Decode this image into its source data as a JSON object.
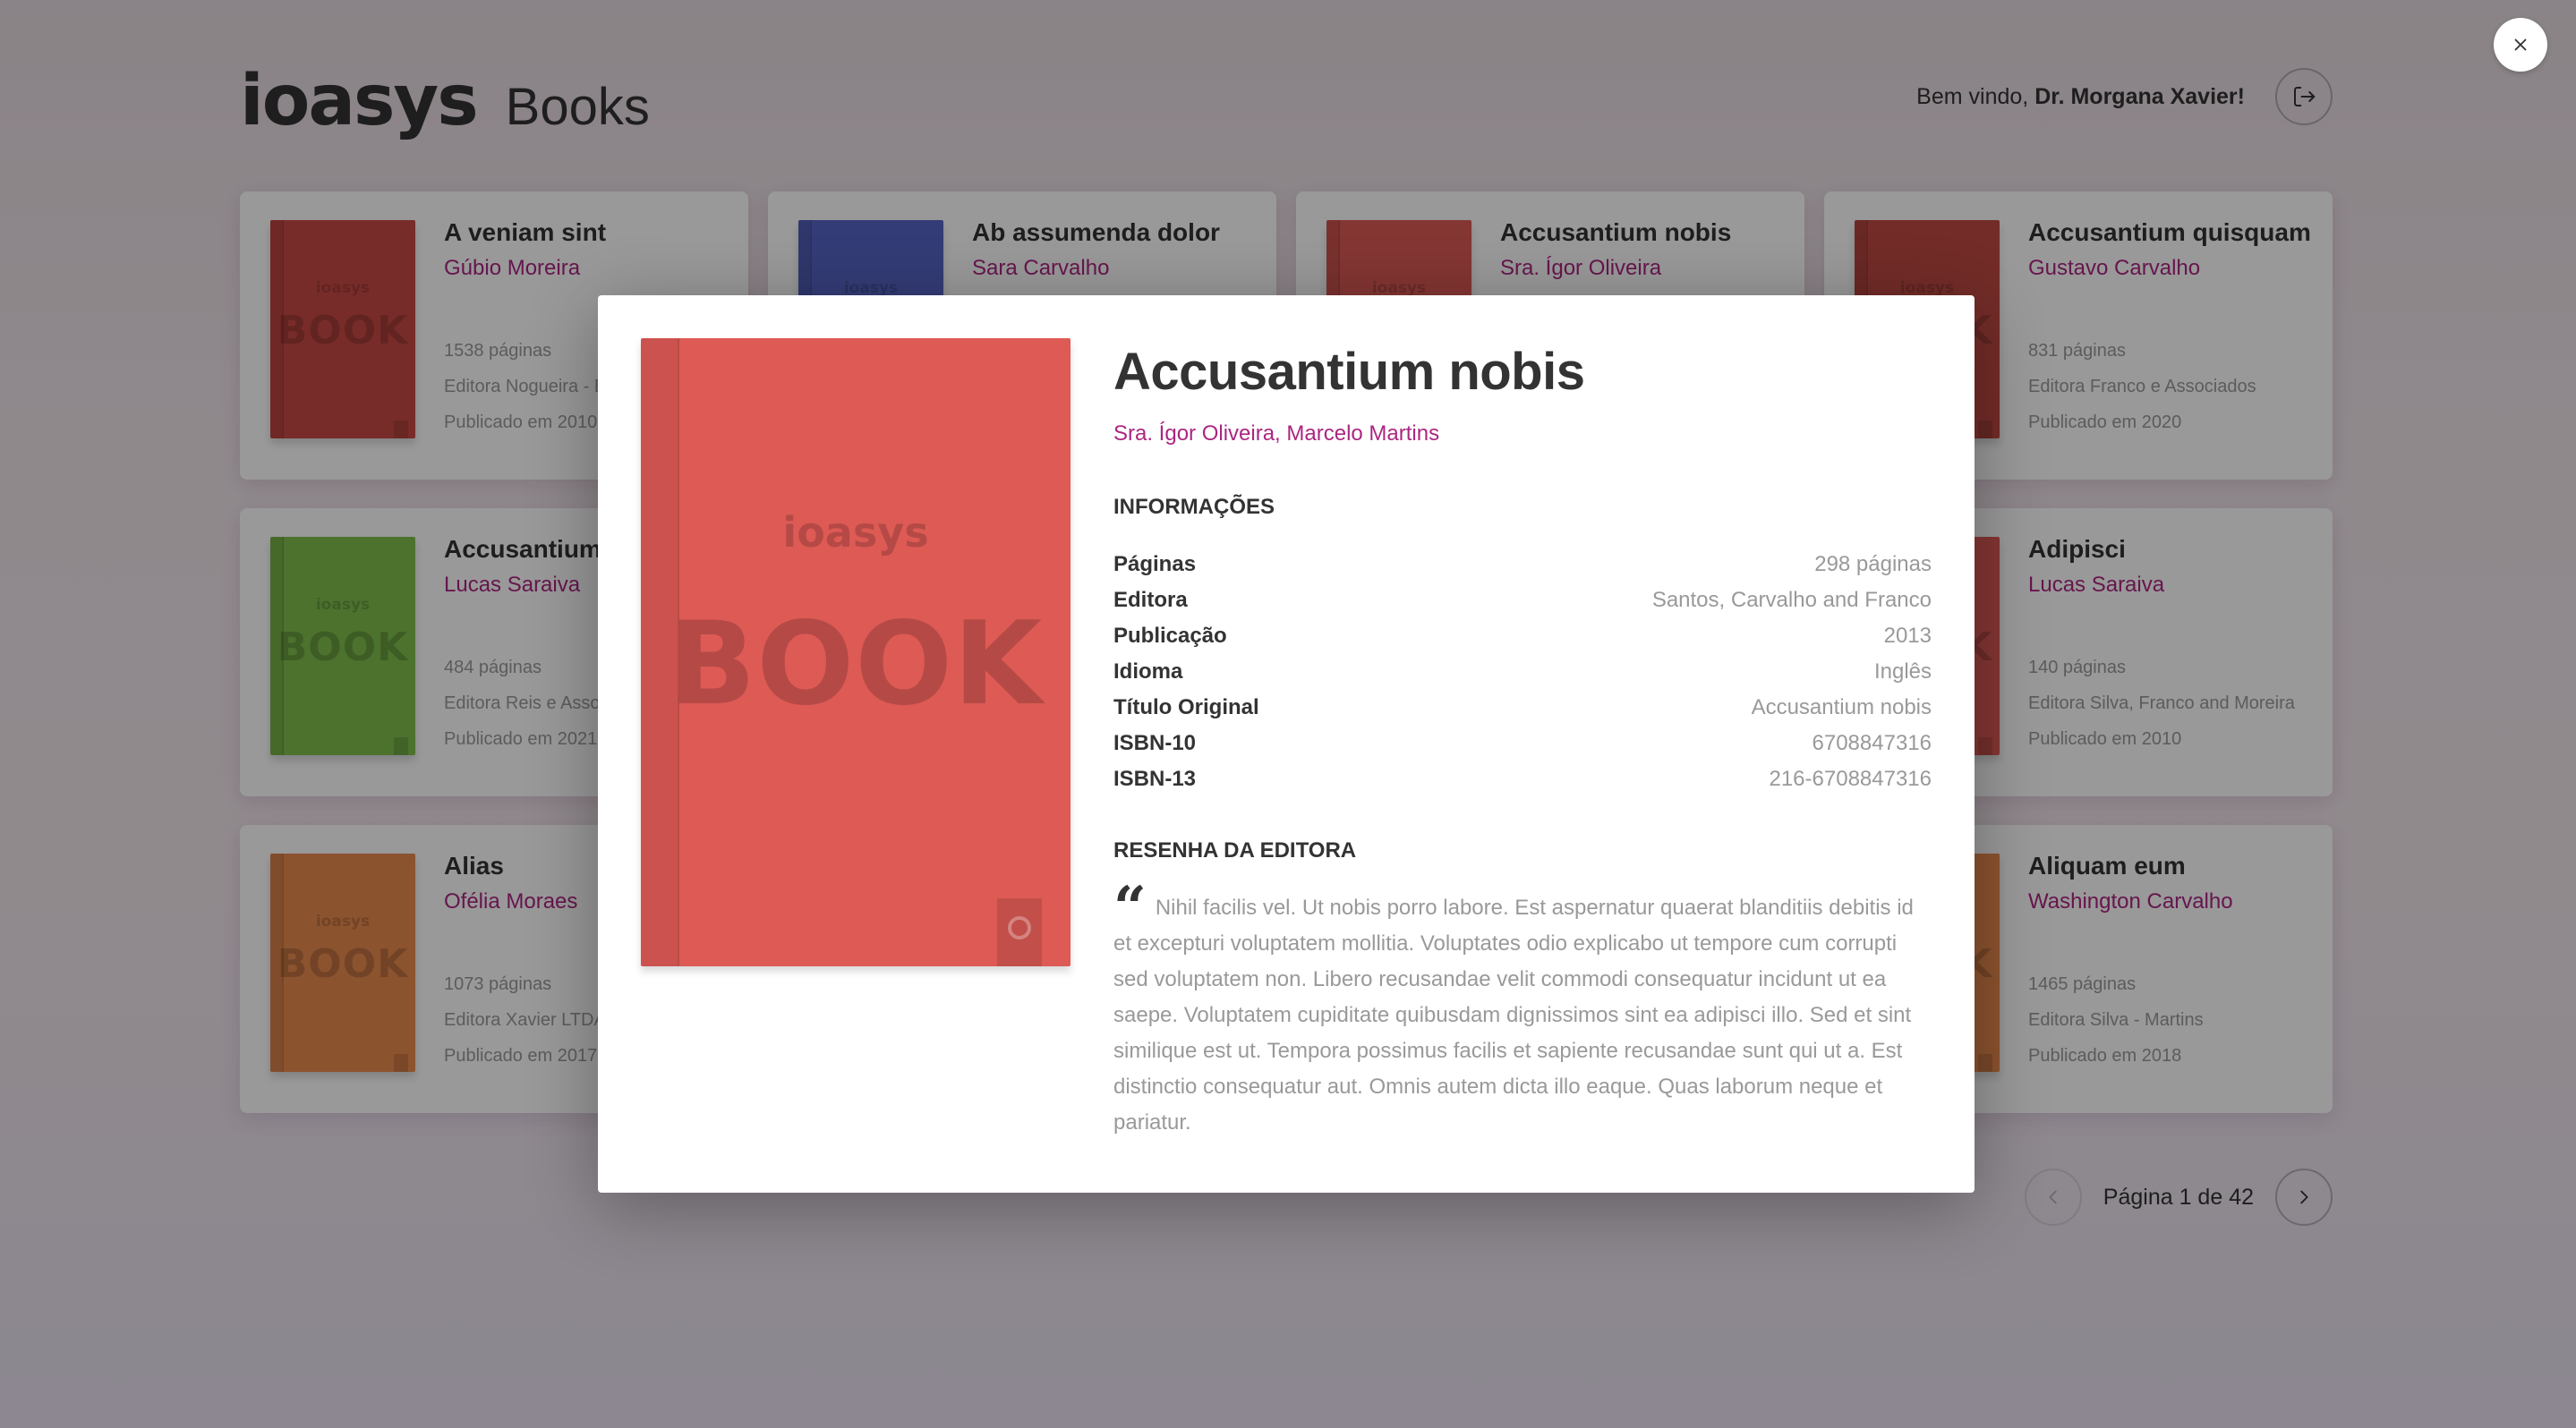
{
  "header": {
    "brand": "ioasys",
    "subtitle": "Books",
    "welcome_prefix": "Bem vindo, ",
    "user_name": "Dr. Morgana Xavier!",
    "logout_icon": "logout-icon"
  },
  "cover_text": {
    "brand": "ioasys",
    "word": "BOOK"
  },
  "books": [
    {
      "title": "A veniam sint",
      "authors": "Gúbio Moreira",
      "pages": "1538 páginas",
      "publisher": "Editora Nogueira - E",
      "published": "Publicado em 2010",
      "color": "#c94a45"
    },
    {
      "title": "Ab assumenda dolor",
      "authors": "Sara Carvalho",
      "pages": "",
      "publisher": "",
      "published": "",
      "color": "#5865c6"
    },
    {
      "title": "Accusantium nobis",
      "authors": "Sra. Ígor Oliveira",
      "pages": "",
      "publisher": "",
      "published": "",
      "color": "#dd5a55"
    },
    {
      "title": "Accusantium quisquam",
      "authors": "Gustavo Carvalho",
      "pages": "831 páginas",
      "publisher": "Editora Franco e Associados",
      "published": "Publicado em 2020",
      "color": "#c04a44"
    },
    {
      "title": "Accusantium",
      "authors": "Lucas Saraiva",
      "pages": "484 páginas",
      "publisher": "Editora Reis e Asso",
      "published": "Publicado em 2021",
      "color": "#7fbe4e"
    },
    {
      "title": "",
      "authors": "",
      "pages": "",
      "publisher": "",
      "published": "",
      "color": "#f1d7df"
    },
    {
      "title": "",
      "authors": "",
      "pages": "",
      "publisher": "",
      "published": "",
      "color": "#f1d7df"
    },
    {
      "title": "Adipisci",
      "authors": "Lucas Saraiva",
      "pages": "140 páginas",
      "publisher": "Editora Silva, Franco and Moreira",
      "published": "Publicado em 2010",
      "color": "#dd5a55"
    },
    {
      "title": "Alias",
      "authors": "Ofélia Moraes",
      "pages": "1073 páginas",
      "publisher": "Editora Xavier LTDA",
      "published": "Publicado em 2017",
      "color": "#e98a4f"
    },
    {
      "title": "",
      "authors": "",
      "pages": "",
      "publisher": "",
      "published": "",
      "color": "#f1d7df"
    },
    {
      "title": "",
      "authors": "",
      "pages": "",
      "publisher": "",
      "published": "",
      "color": "#f1d7df"
    },
    {
      "title": "Aliquam eum",
      "authors": "Washington Carvalho",
      "pages": "1465 páginas",
      "publisher": "Editora Silva - Martins",
      "published": "Publicado em 2018",
      "color": "#e98a4f"
    }
  ],
  "pagination": {
    "label": "Página 1 de 42",
    "prev_icon": "chevron-left-icon",
    "next_icon": "chevron-right-icon"
  },
  "modal": {
    "title": "Accusantium nobis",
    "authors": "Sra. Ígor Oliveira, Marcelo Martins",
    "cover_color": "#dd5a55",
    "info_heading": "INFORMAÇÕES",
    "info": [
      {
        "label": "Páginas",
        "value": "298 páginas"
      },
      {
        "label": "Editora",
        "value": "Santos, Carvalho and Franco"
      },
      {
        "label": "Publicação",
        "value": "2013"
      },
      {
        "label": "Idioma",
        "value": "Inglês"
      },
      {
        "label": "Título Original",
        "value": "Accusantium nobis"
      },
      {
        "label": "ISBN-10",
        "value": "6708847316"
      },
      {
        "label": "ISBN-13",
        "value": "216-6708847316"
      }
    ],
    "review_heading": "RESENHA DA EDITORA",
    "quote_mark": "“",
    "review": "Nihil facilis vel. Ut nobis porro labore. Est aspernatur quaerat blanditiis debitis id et excepturi voluptatem mollitia. Voluptates odio explicabo ut tempore cum corrupti sed voluptatem non. Libero recusandae velit commodi consequatur incidunt ut ea saepe. Voluptatem cupiditate quibusdam dignissimos sint ea adipisci illo. Sed et sint similique est ut. Tempora possimus facilis et sapiente recusandae sunt qui ut a. Est distinctio consequatur aut. Omnis autem dicta illo eaque. Quas laborum neque et pariatur.",
    "close_icon": "close-icon"
  },
  "colors": {
    "accent": "#ab2680",
    "text": "#333333",
    "muted": "#999999"
  }
}
